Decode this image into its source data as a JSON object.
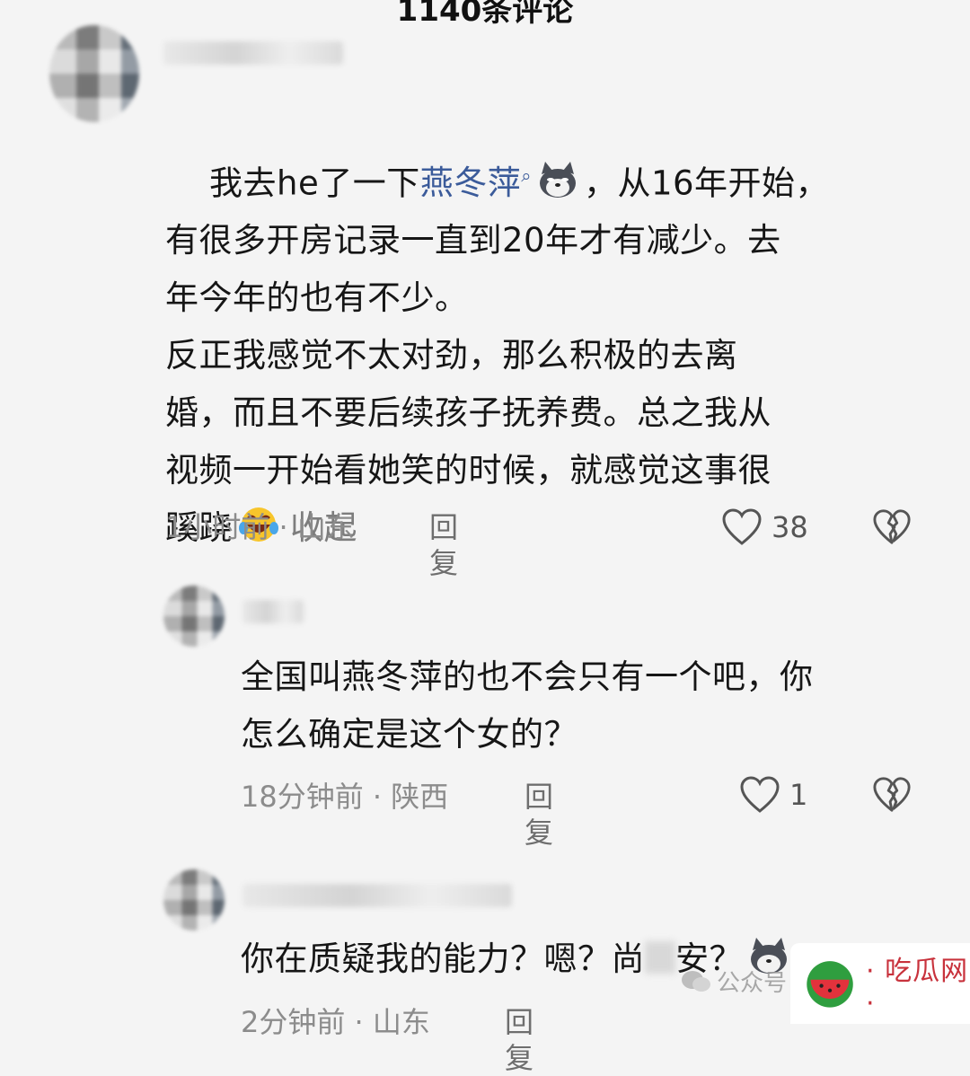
{
  "header": {
    "title": "1140条评论"
  },
  "comments": [
    {
      "text_before_link": "我去he了一下",
      "link": "燕冬萍",
      "text_after_emoji": "，从16年开始，\n有很多开房记录一直到20年才有减少。去\n年今年的也有不少。\n反正我感觉不太对劲，那么积极的去离\n婚，而且不要后续孩子抚养费。总之我从\n视频一开始看她笑的时候，就感觉这事很\n蹊跷",
      "collapse_label": "收起",
      "meta": "1小时前 · 山东",
      "reply_label": "回复",
      "likes": "38"
    },
    {
      "text": "全国叫燕冬萍的也不会只有一个吧，你\n怎么确定是这个女的？",
      "meta": "18分钟前 · 陕西",
      "reply_label": "回复",
      "likes": "1"
    },
    {
      "text": "你在质疑我的能力？嗯？尚",
      "text_tail": "安？",
      "meta": "2分钟前 · 山东",
      "reply_label": "回复"
    }
  ],
  "watermark": {
    "text": "公众号",
    "brand": "· 吃瓜网 ·"
  },
  "colors": {
    "link": "#3b5b9a",
    "meta": "#8c8c8c",
    "text": "#161616",
    "background": "#f4f4f4"
  },
  "icons": [
    "search-icon",
    "dog-emoji-icon",
    "laugh-cry-emoji-icon",
    "heart-icon",
    "broken-heart-icon",
    "wechat-icon",
    "watermelon-icon"
  ]
}
